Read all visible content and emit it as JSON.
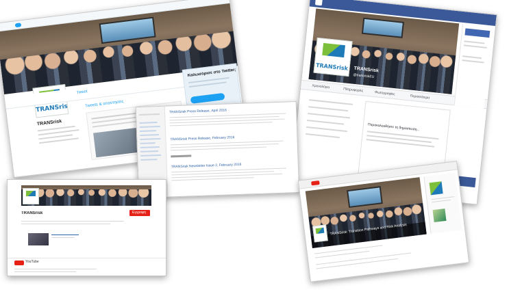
{
  "twitter": {
    "profile_name": "TRANSrisk",
    "profile_logo_text": "TRANSrisk",
    "panel_title": "Καλωσόρισε στο Twitter;",
    "tweets_tab": "Tweets & απαντήσεις",
    "tweets_label": "Tweet",
    "colors": {
      "accent": "#1da1f2",
      "panel": "#e8f1f8"
    }
  },
  "facebook": {
    "page_name": "TRANSrisk",
    "page_handle": "@transriskEU",
    "tab_timeline": "Χρονολόγιο",
    "tab_about": "Πληροφορίες",
    "tab_photos": "Φωτογραφίες",
    "tab_more": "Περισσότερα",
    "post_text": "Παρακολουθήστε τη δημοσίευση...",
    "colors": {
      "brand": "#3b5998"
    }
  },
  "newsletter": {
    "items": [
      "TRANSrisk Press Release, Αpril 2016",
      "TRANSrisk Press Release, February 2016",
      "TRANSrisk Newsletter Issue 2, February 2016"
    ]
  },
  "youtube": {
    "channel_name": "TRANSrisk",
    "subscribe_label": "Εγγραφή",
    "logo_text": "YouTube",
    "colors": {
      "brand": "#e62117"
    }
  },
  "youtube_video": {
    "title": "TRANSrisk: Transition Pathways and Risk Analysis",
    "logo_text": "TRANSrisk"
  }
}
